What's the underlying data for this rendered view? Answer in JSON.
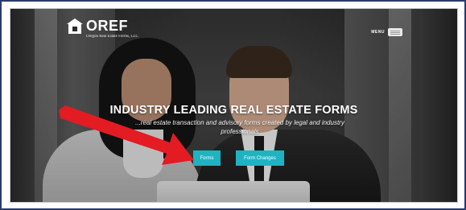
{
  "header": {
    "logo_title": "OREF",
    "logo_subtitle": "Oregon Real Estate Forms, LLC",
    "menu_label": "MENU"
  },
  "hero": {
    "headline": "INDUSTRY LEADING REAL ESTATE FORMS",
    "subline": "...real estate transaction and advisory forms created by legal and industry professionals",
    "buttons": {
      "forms": "Forms",
      "form_changes": "Form Changes"
    }
  },
  "colors": {
    "button": "#1fb3c2",
    "annotation_arrow": "#e31b23",
    "frame_border": "#2b3a6b"
  },
  "icons": {
    "logo": "house-logo-icon",
    "menu": "hamburger-menu-icon",
    "annotation": "red-arrow-icon"
  }
}
